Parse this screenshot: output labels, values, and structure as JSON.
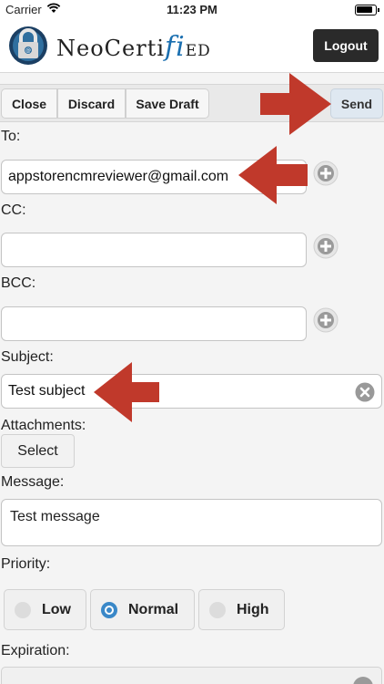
{
  "status_bar": {
    "carrier": "Carrier",
    "time": "11:23 PM"
  },
  "header": {
    "brand_part1": "NeoCerti",
    "brand_fi": "fi",
    "brand_part2": "ed",
    "logout_label": "Logout"
  },
  "toolbar": {
    "close_label": "Close",
    "discard_label": "Discard",
    "save_draft_label": "Save Draft",
    "send_label": "Send"
  },
  "form": {
    "to_label": "To:",
    "to_value": "appstorencmreviewer@gmail.com",
    "cc_label": "CC:",
    "cc_value": "",
    "bcc_label": "BCC:",
    "bcc_value": "",
    "subject_label": "Subject:",
    "subject_value": "Test subject",
    "attachments_label": "Attachments:",
    "select_label": "Select",
    "message_label": "Message:",
    "message_value": "Test message",
    "priority_label": "Priority:",
    "priority_options": [
      "Low",
      "Normal",
      "High"
    ],
    "priority_selected": "Normal",
    "expiration_label": "Expiration:"
  },
  "colors": {
    "accent": "#3a88c8",
    "brand_blue": "#1a6fb0",
    "annotation_arrow": "#c0392b",
    "logout_bg": "#2a2a2a"
  },
  "icons": [
    "wifi-icon",
    "battery-icon",
    "padlock-logo-icon",
    "add-circle-icon",
    "clear-circle-icon",
    "red-arrow-annotation"
  ]
}
